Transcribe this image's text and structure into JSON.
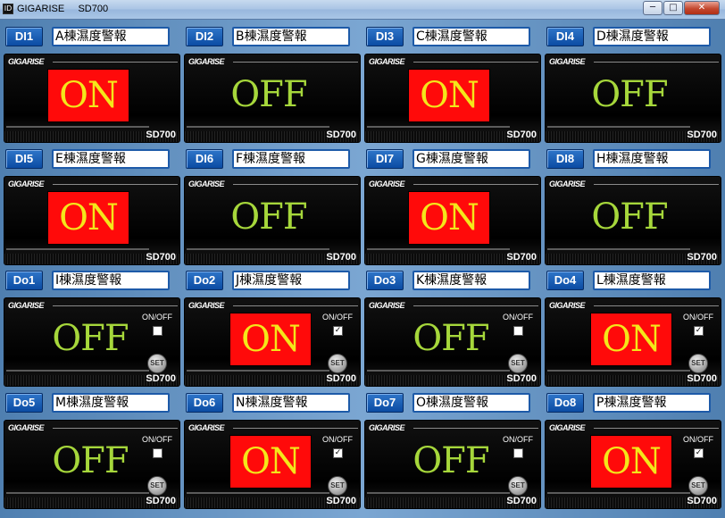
{
  "window": {
    "title": "GIGARISE     SD700",
    "app_icon": "ID",
    "minimize_icon": "─",
    "maximize_icon": "□",
    "close_icon": "✕"
  },
  "common": {
    "logo": "GIGARISE",
    "model": "SD700",
    "onoff_label": "ON/OFF",
    "set_label": "SET",
    "check_mark": "✓"
  },
  "cells": [
    {
      "tag": "DI1",
      "name": "A棟濕度警報",
      "status": "ON",
      "type": "di"
    },
    {
      "tag": "DI2",
      "name": "B棟濕度警報",
      "status": "OFF",
      "type": "di"
    },
    {
      "tag": "DI3",
      "name": "C棟濕度警報",
      "status": "ON",
      "type": "di"
    },
    {
      "tag": "DI4",
      "name": "D棟濕度警報",
      "status": "OFF",
      "type": "di"
    },
    {
      "tag": "DI5",
      "name": "E棟濕度警報",
      "status": "ON",
      "type": "di"
    },
    {
      "tag": "DI6",
      "name": "F棟濕度警報",
      "status": "OFF",
      "type": "di"
    },
    {
      "tag": "DI7",
      "name": "G棟濕度警報",
      "status": "ON",
      "type": "di"
    },
    {
      "tag": "DI8",
      "name": "H棟濕度警報",
      "status": "OFF",
      "type": "di"
    },
    {
      "tag": "Do1",
      "name": "I棟濕度警報",
      "status": "OFF",
      "type": "do",
      "checked": false
    },
    {
      "tag": "Do2",
      "name": "J棟濕度警報",
      "status": "ON",
      "type": "do",
      "checked": true
    },
    {
      "tag": "Do3",
      "name": "K棟濕度警報",
      "status": "OFF",
      "type": "do",
      "checked": false
    },
    {
      "tag": "Do4",
      "name": "L棟濕度警報",
      "status": "ON",
      "type": "do",
      "checked": true
    },
    {
      "tag": "Do5",
      "name": "M棟濕度警報",
      "status": "OFF",
      "type": "do",
      "checked": false
    },
    {
      "tag": "Do6",
      "name": "N棟濕度警報",
      "status": "ON",
      "type": "do",
      "checked": true
    },
    {
      "tag": "Do7",
      "name": "O棟濕度警報",
      "status": "OFF",
      "type": "do",
      "checked": false
    },
    {
      "tag": "Do8",
      "name": "P棟濕度警報",
      "status": "ON",
      "type": "do",
      "checked": true
    }
  ],
  "colors": {
    "on_bg": "#ff0a0a",
    "on_text": "#f4e71a",
    "off_text": "#a6d73b",
    "tag_bg": "#0b4ca3"
  }
}
